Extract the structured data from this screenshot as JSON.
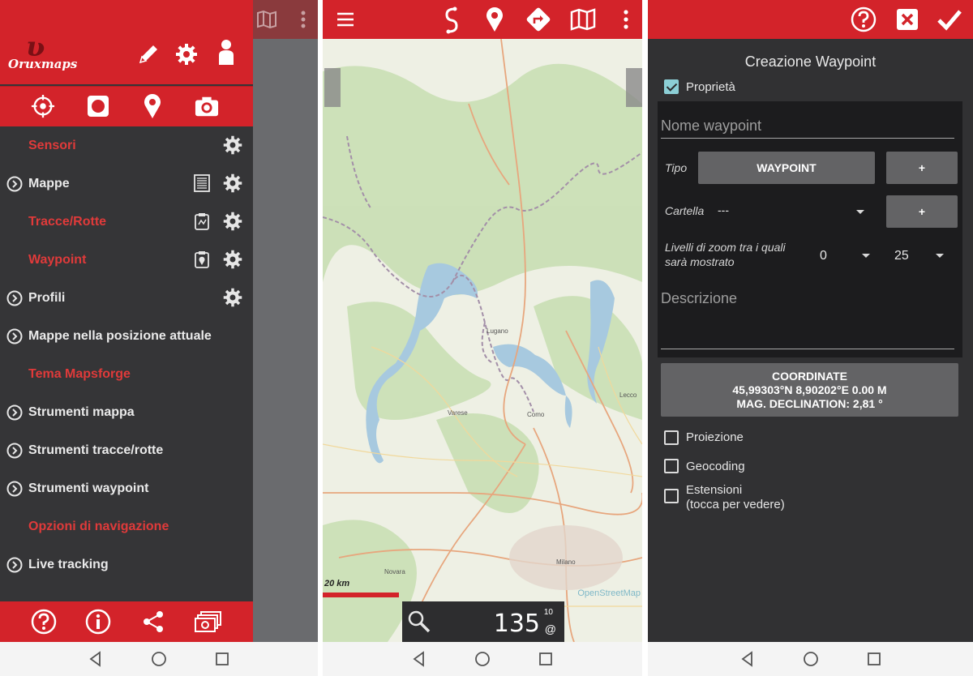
{
  "panel1": {
    "logo_text": "Oruxmaps",
    "menu": [
      {
        "label": "Sensori",
        "type": "section",
        "gear": true
      },
      {
        "label": "Mappe",
        "type": "item",
        "gear": true,
        "list_icon": "list-icon"
      },
      {
        "label": "Tracce/Rotte",
        "type": "section",
        "gear": true,
        "list_icon": "clipboard-icon"
      },
      {
        "label": "Waypoint",
        "type": "section",
        "gear": true,
        "list_icon": "clipboard-pin-icon"
      },
      {
        "label": "Profili",
        "type": "item",
        "gear": true
      },
      {
        "label": "Mappe nella posizione attuale",
        "type": "item"
      },
      {
        "label": "Tema Mapsforge",
        "type": "section"
      },
      {
        "label": "Strumenti mappa",
        "type": "item"
      },
      {
        "label": "Strumenti tracce/rotte",
        "type": "item"
      },
      {
        "label": "Strumenti waypoint",
        "type": "item"
      },
      {
        "label": "Opzioni di navigazione",
        "type": "section"
      },
      {
        "label": "Live tracking",
        "type": "item"
      }
    ],
    "header_icons": [
      "pencil-icon",
      "gear-icon",
      "user-icon"
    ],
    "toolbar_icons": [
      "crosshair-icon",
      "record-icon",
      "pin-icon",
      "camera-icon"
    ],
    "footer_icons": [
      "help-icon",
      "info-icon",
      "share-icon",
      "money-icon"
    ]
  },
  "panel2": {
    "toolbar_icons": [
      "hamburger-menu-icon",
      "route-icon",
      "pin-icon",
      "turn-icon",
      "map-icon",
      "overflow-menu-icon"
    ],
    "scale_label": "20 km",
    "zoom_value": "135",
    "zoom_sup": "10",
    "zoom_at": "@",
    "attribution": "OpenStreetMap",
    "map_labels": [
      "Milano",
      "Lugano",
      "Como",
      "Varese",
      "Lecco",
      "Novara"
    ]
  },
  "panel3": {
    "title": "Creazione Waypoint",
    "proprieta_label": "Proprietà",
    "name_placeholder": "Nome waypoint",
    "tipo_label": "Tipo",
    "tipo_value": "WAYPOINT",
    "plus_label": "+",
    "cartella_label": "Cartella",
    "cartella_value": "---",
    "zoom_label_1": "Livelli di zoom tra i quali",
    "zoom_label_2": "sarà mostrato",
    "zoom_min": "0",
    "zoom_max": "25",
    "descrizione_placeholder": "Descrizione",
    "coord_title": "COORDINATE",
    "coord_value": "45,99303°N 8,90202°E 0.00 M",
    "coord_decl": "MAG. DECLINATION: 2,81 °",
    "proiezione_label": "Proiezione",
    "geocoding_label": "Geocoding",
    "estensioni_label_1": "Estensioni",
    "estensioni_label_2": "(tocca per vedere)",
    "toolbar_icons": [
      "help-icon",
      "close-icon",
      "check-icon"
    ]
  },
  "colors": {
    "accent": "#d3232a",
    "drawer_bg": "#353537",
    "section_text": "#e03a3a"
  }
}
